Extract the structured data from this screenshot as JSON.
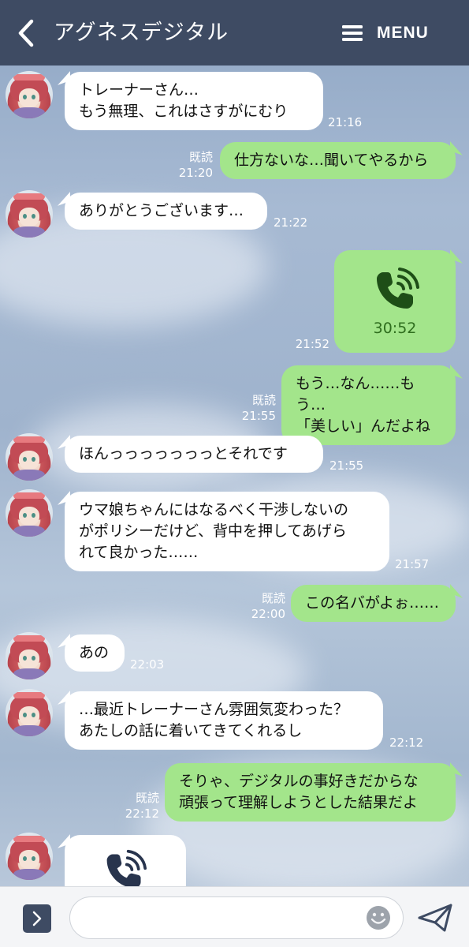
{
  "header": {
    "title": "アグネスデジタル",
    "menu_label": "MENU"
  },
  "messages": [
    {
      "side": "in",
      "text": "トレーナーさん…\nもう無理、これはさすがにむり",
      "time": "21:16"
    },
    {
      "side": "out",
      "text": "仕方ないな…聞いてやるから",
      "read": "既読",
      "time": "21:20"
    },
    {
      "side": "in",
      "text": "ありがとうございます…",
      "time": "21:22"
    },
    {
      "side": "out",
      "type": "call",
      "duration": "30:52",
      "time": "21:52"
    },
    {
      "side": "out",
      "text": "もう…なん……もう…\n「美しい」んだよね",
      "read": "既読",
      "time": "21:55"
    },
    {
      "side": "in",
      "text": "ほんっっっっっっっとそれです",
      "time": "21:55"
    },
    {
      "side": "in",
      "text": "ウマ娘ちゃんにはなるべく干渉しないの\nがポリシーだけど、背中を押してあげら\nれて良かった……",
      "time": "21:57"
    },
    {
      "side": "out",
      "text": "この名バがよぉ……",
      "read": "既読",
      "time": "22:00"
    },
    {
      "side": "in",
      "text": "あの",
      "time": "22:03"
    },
    {
      "side": "in",
      "text": "…最近トレーナーさん雰囲気変わった？\nあたしの話に着いてきてくれるし",
      "time": "22:12"
    },
    {
      "side": "out",
      "text": "そりゃ、デジタルの事好きだからな\n頑張って理解しようとした結果だよ",
      "read": "既読",
      "time": "22:12"
    },
    {
      "side": "in",
      "type": "call"
    }
  ],
  "input": {
    "value": "",
    "placeholder": ""
  },
  "icons": {
    "back": "chevron-left-icon",
    "menu": "hamburger-icon",
    "call": "phone-call-icon",
    "expand": "chevron-right-icon",
    "emoji": "smiley-icon",
    "send": "paper-plane-icon"
  },
  "colors": {
    "header_bg": "#3e4b63",
    "outgoing_bubble": "#a3e58b",
    "incoming_bubble": "#ffffff",
    "call_duration_text": "#2f6e1e"
  }
}
